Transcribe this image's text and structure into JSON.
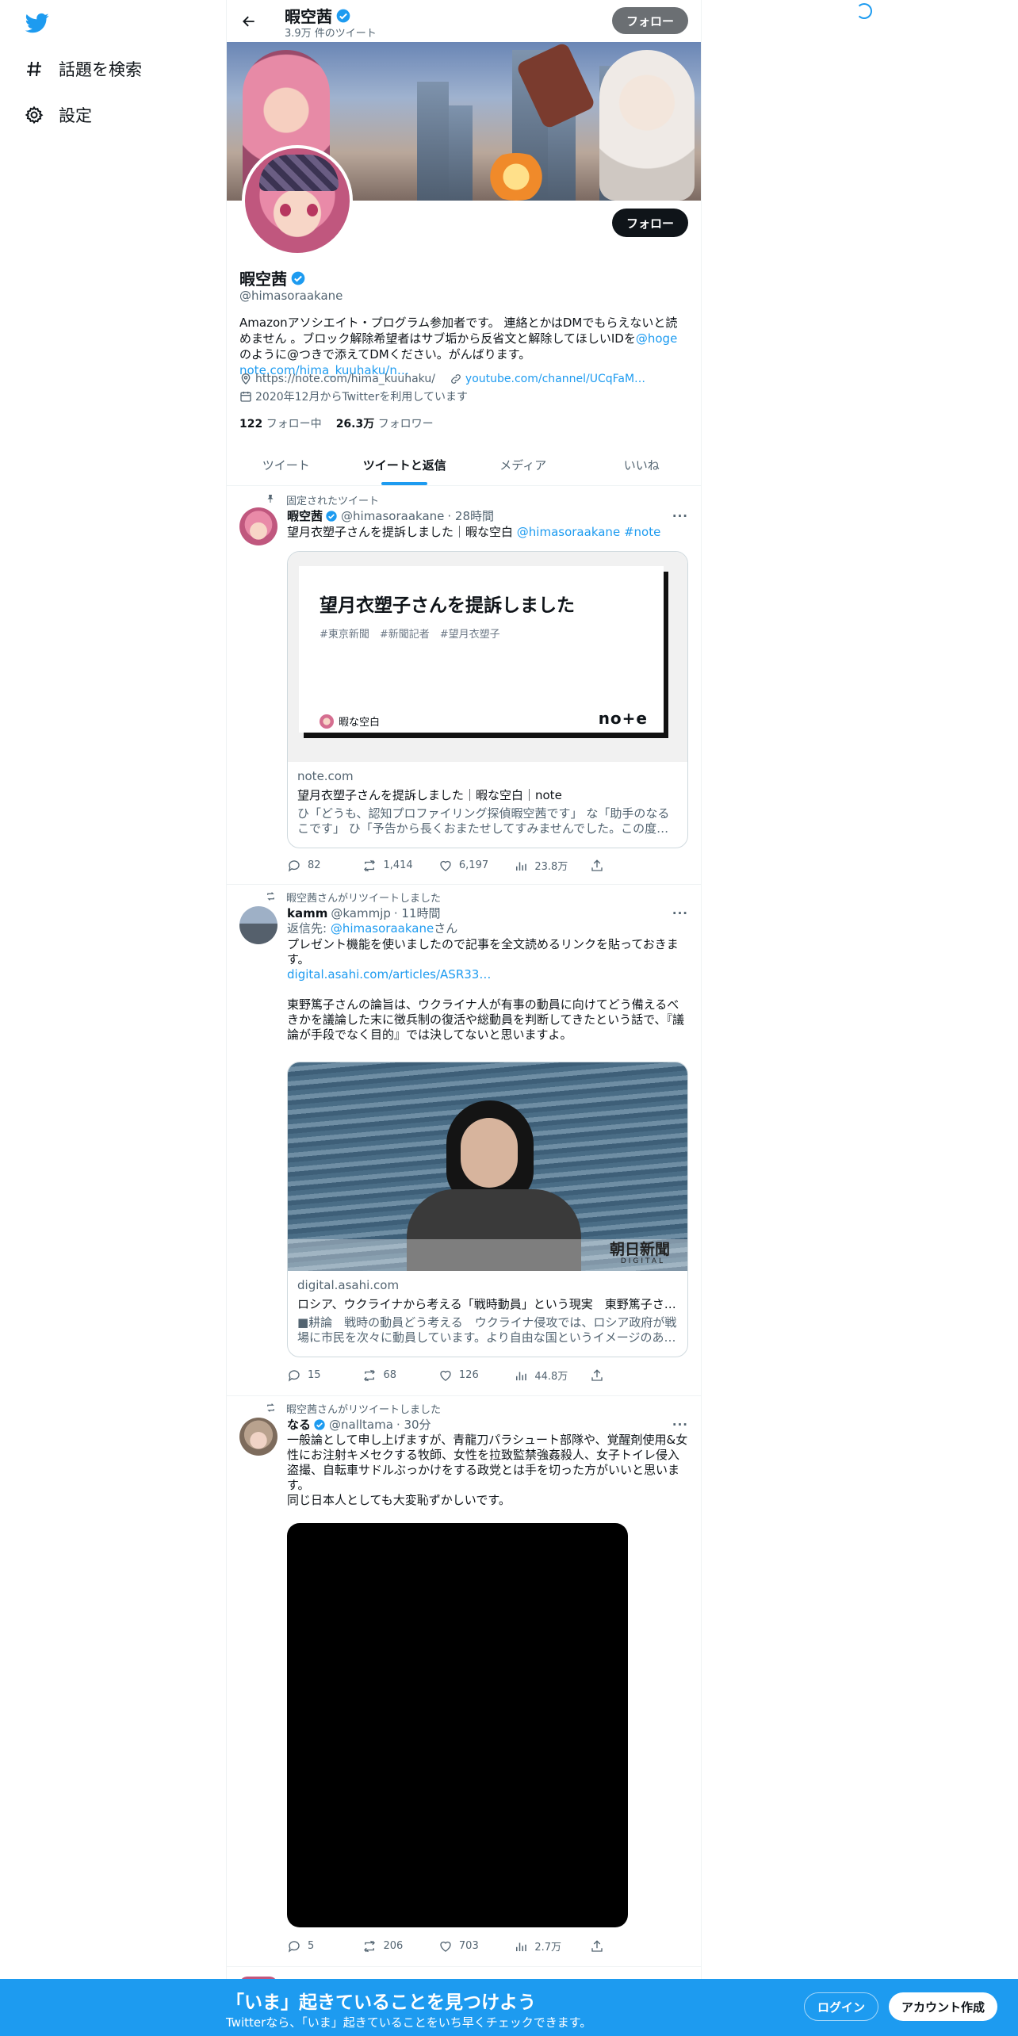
{
  "nav": {
    "explore_label": "話題を検索",
    "settings_label": "設定"
  },
  "topbar": {
    "name": "暇空茜",
    "tweet_count": "3.9万 件のツイート",
    "follow_label": "フォロー"
  },
  "profile": {
    "name": "暇空茜",
    "handle": "@himasoraakane",
    "follow_label": "フォロー",
    "bio_1": "Amazonアソシエイト・プログラム参加者です。 連絡とかはDMでもらえないと読めません 。ブロック解除希望者はサブ垢から反省文と解除してほしいIDを",
    "bio_mention": "@hoge",
    "bio_2": "のように@つきで添えてDMください。がんばります。",
    "bio_link": "note.com/hima_kuuhaku/n…",
    "location": "https://note.com/hima_kuuhaku/",
    "url": "youtube.com/channel/UCqFaM…",
    "joined": "2020年12月からTwitterを利用しています",
    "following_count": "122",
    "following_label": "フォロー中",
    "followers_count": "26.3万",
    "followers_label": "フォロワー"
  },
  "tabs": [
    "ツイート",
    "ツイートと返信",
    "メディア",
    "いいね"
  ],
  "tweets": [
    {
      "social": "固定されたツイート",
      "name": "暇空茜",
      "handle": "@himasoraakane",
      "time": "· 28時間",
      "text": "望月衣塑子さんを提訴しました｜暇な空白",
      "text_mention": "@himasoraakane",
      "text_tag": "#note",
      "card_heading": "望月衣塑子さんを提訴しました",
      "card_tags": "#東京新聞　#新聞記者　#望月衣塑子",
      "card_author": "暇な空白",
      "card_brand": "no+e",
      "card_domain": "note.com",
      "card_title": "望月衣塑子さんを提訴しました｜暇な空白｜note",
      "card_desc": "ひ「どうも、認知プロファイリング探偵暇空茜です」 な「助手のなるこです」 ひ「予告から長くおまたせしてすみませんでした。この度…",
      "replies": "82",
      "retweets": "1,414",
      "likes": "6,197",
      "views": "23.8万"
    },
    {
      "social": "暇空茜さんがリツイートしました",
      "name": "kamm",
      "handle": "@kammjp",
      "time": "· 11時間",
      "reply_to_label": "返信先: ",
      "reply_to_handle": "@himasoraakane",
      "reply_to_suffix": "さん",
      "text_1": "プレゼント機能を使いましたので記事を全文読めるリンクを貼っておきます。",
      "text_link": "digital.asahi.com/articles/ASR33…",
      "text_2": "東野篤子さんの論旨は、ウクライナ人が有事の動員に向けてどう備えるべきかを議論した末に徴兵制の復活や総動員を判断してきたという話で、『議論が手段でなく目的』では決してないと思いますよ。",
      "card_watermark": "朝日新聞",
      "card_watermark_sub": "DIGITAL",
      "card_domain": "digital.asahi.com",
      "card_title": "ロシア、ウクライナから考える「戦時動員」という現実　東野篤子さ…",
      "card_desc": "■耕論　戦時の動員どう考える　ウクライナ侵攻では、ロシア政府が戦場に市民を次々に動員しています。より自由な国というイメージのあ…",
      "replies": "15",
      "retweets": "68",
      "likes": "126",
      "views": "44.8万"
    },
    {
      "social": "暇空茜さんがリツイートしました",
      "name": "なる",
      "handle": "@nalltama",
      "time": "· 30分",
      "text": "一般論として申し上げますが、青龍刀パラシュート部隊や、覚醒剤使用&女性にお注射キメセクする牧師、女性を拉致監禁強姦殺人、女子トイレ侵入盗撮、自転車サドルぶっかけをする政党とは手を切った方がいいと思います。\n同じ日本人としても大変恥ずかしいです。",
      "replies": "5",
      "retweets": "206",
      "likes": "703",
      "views": "2.7万"
    }
  ],
  "bottombar": {
    "title": "「いま」起きていることを見つけよう",
    "subtitle": "Twitterなら、「いま」起きていることをいち早くチェックできます。",
    "login_label": "ログイン",
    "signup_label": "アカウント作成"
  },
  "colors": {
    "accent": "#1d9bf0",
    "text": "#0f1419",
    "secondary": "#536471"
  }
}
